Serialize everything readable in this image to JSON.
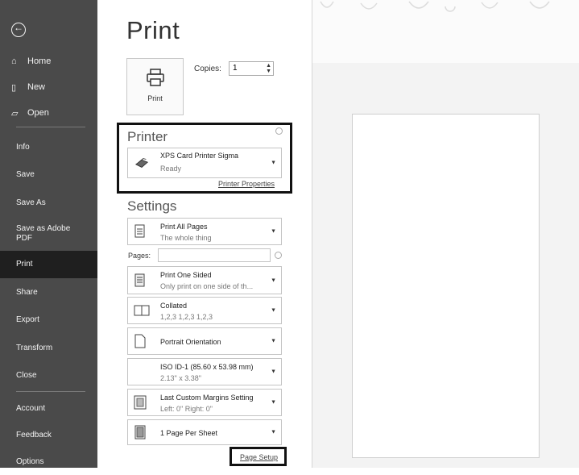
{
  "sidebar": {
    "top_items": [
      {
        "label": "Home",
        "icon": "home-icon"
      },
      {
        "label": "New",
        "icon": "new-document-icon"
      },
      {
        "label": "Open",
        "icon": "folder-open-icon"
      }
    ],
    "mid_items": [
      {
        "label": "Info"
      },
      {
        "label": "Save"
      },
      {
        "label": "Save As"
      },
      {
        "label": "Save as Adobe PDF"
      },
      {
        "label": "Print"
      },
      {
        "label": "Share"
      },
      {
        "label": "Export"
      },
      {
        "label": "Transform"
      },
      {
        "label": "Close"
      }
    ],
    "bottom_items": [
      {
        "label": "Account"
      },
      {
        "label": "Feedback"
      },
      {
        "label": "Options"
      }
    ],
    "active": "Print"
  },
  "page_title": "Print",
  "print_button_label": "Print",
  "copies": {
    "label": "Copies:",
    "value": "1"
  },
  "printer": {
    "heading": "Printer",
    "name": "XPS Card Printer Sigma",
    "status": "Ready",
    "properties_link": "Printer Properties"
  },
  "settings": {
    "heading": "Settings",
    "pages_label": "Pages:",
    "options": [
      {
        "title": "Print All Pages",
        "sub": "The whole thing"
      },
      {
        "title": "Print One Sided",
        "sub": "Only print on one side of th..."
      },
      {
        "title": "Collated",
        "sub": "1,2,3   1,2,3   1,2,3"
      },
      {
        "title": "Portrait Orientation",
        "sub": ""
      },
      {
        "title": "ISO ID-1 (85.60 x 53.98 mm)",
        "sub": "2.13\" x 3.38\""
      },
      {
        "title": "Last Custom Margins Setting",
        "sub": "Left: 0\"    Right: 0\""
      },
      {
        "title": "1 Page Per Sheet",
        "sub": ""
      }
    ],
    "page_setup_link": "Page Setup"
  },
  "colors": {
    "sidebar_bg": "#4a4a4a",
    "active_bg": "#1f1f1f",
    "highlight_frame": "#111111"
  }
}
